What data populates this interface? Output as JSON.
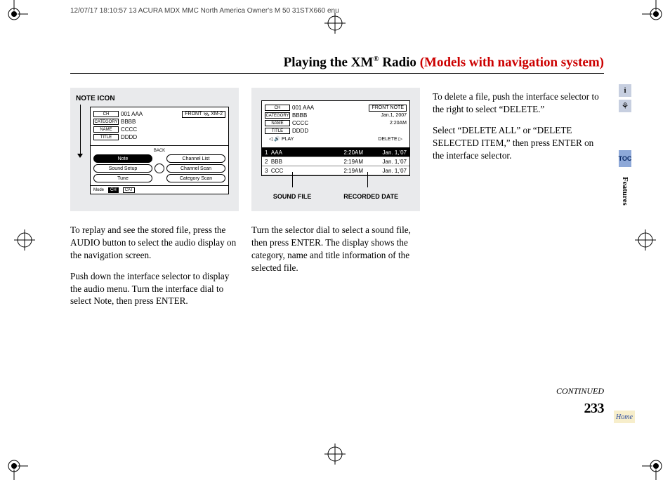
{
  "print_header": "12/07/17 18:10:57   13 ACURA MDX MMC North America Owner's M 50 31STX660 enu",
  "title": {
    "before": "Playing the XM",
    "sup": "®",
    "mid": " Radio ",
    "red": "(Models with navigation system)"
  },
  "col1": {
    "figure_label": "NOTE ICON",
    "screen": {
      "ch_tag": "CH",
      "ch_val": "001 AAA",
      "cat_tag": "CATEGORY",
      "cat_val": "BBBB",
      "name_tag": "NAME",
      "name_val": "CCCC",
      "title_tag": "TITLE",
      "title_val": "DDDD",
      "front": "FRONT",
      "xm": "XM-2",
      "back": "BACK",
      "menu": {
        "note": "Note",
        "chlist": "Channel List",
        "ss": "Sound Setup",
        "cscan": "Channel Scan",
        "tune": "Tune",
        "catscan": "Category Scan"
      },
      "mode": "Mode",
      "chbtn": "CH",
      "catbtn": "CAT"
    },
    "p1": "To replay and see the stored file, press the AUDIO button to select the audio display on the navigation screen.",
    "p2": "Push down the interface selector to display the audio menu. Turn the interface dial to select Note, then press ENTER."
  },
  "col2": {
    "screen": {
      "ch_tag": "CH",
      "ch_val": "001 AAA",
      "cat_tag": "CATEGORY",
      "cat_val": "BBBB",
      "name_tag": "NAME",
      "name_val": "CCCC",
      "title_tag": "TITLE",
      "title_val": "DDDD",
      "front": "FRONT",
      "note": "NOTE",
      "date": "Jan.1, 2007",
      "time": "2:20AM",
      "play": "PLAY",
      "delete": "DELETE",
      "rows": [
        {
          "n": "1",
          "name": "AAA",
          "t": "2:20AM",
          "d": "Jan. 1,'07"
        },
        {
          "n": "2",
          "name": "BBB",
          "t": "2:19AM",
          "d": "Jan. 1,'07"
        },
        {
          "n": "3",
          "name": "CCC",
          "t": "2:19AM",
          "d": "Jan. 1,'07"
        }
      ]
    },
    "label_left": "SOUND FILE",
    "label_right": "RECORDED DATE",
    "p1": "Turn the selector dial to select a sound file, then press ENTER. The display shows the category, name and title information of the selected file."
  },
  "col3": {
    "p1": "To delete a file, push the interface selector to the right to select “DELETE.”",
    "p2": "Select “DELETE ALL” or “DELETE SELECTED ITEM,” then press ENTER on the interface selector."
  },
  "continued": "CONTINUED",
  "page_num": "233",
  "tabs": {
    "toc": "TOC",
    "features": "Features",
    "home": "Home"
  }
}
